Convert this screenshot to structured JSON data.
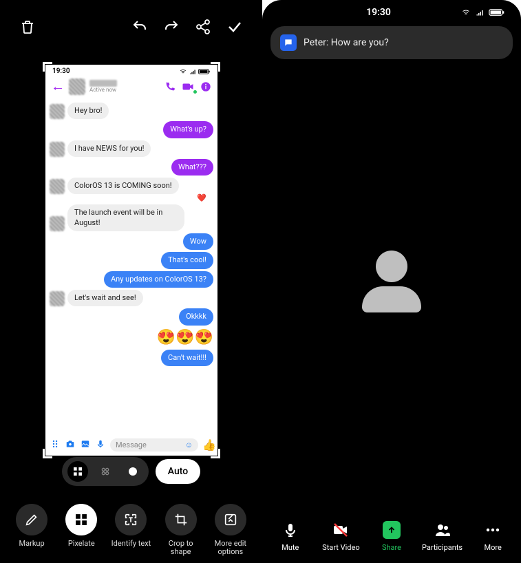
{
  "left": {
    "toolbar": {
      "auto_label": "Auto"
    },
    "tools": [
      {
        "label": "Markup"
      },
      {
        "label": "Pixelate"
      },
      {
        "label": "Identify text"
      },
      {
        "label": "Crop to shape"
      },
      {
        "label": "More edit options"
      }
    ],
    "shot": {
      "status_time": "19:30",
      "active_text": "Active now",
      "input_placeholder": "Message",
      "messages": [
        {
          "dir": "in",
          "text": "Hey bro!",
          "avatar": true
        },
        {
          "dir": "out",
          "style": "purple",
          "text": "What's up?"
        },
        {
          "dir": "in",
          "text": "I have NEWS for you!",
          "avatar": true
        },
        {
          "dir": "out",
          "style": "purple",
          "text": "What???"
        },
        {
          "dir": "in",
          "text": "ColorOS 13 is COMING soon!",
          "avatar": true,
          "react": "❤️"
        },
        {
          "dir": "in",
          "text": "The launch event will be in August!",
          "avatar": true
        },
        {
          "dir": "out",
          "style": "blue",
          "text": "Wow"
        },
        {
          "dir": "out",
          "style": "blue",
          "text": "That's cool!"
        },
        {
          "dir": "out",
          "style": "blue",
          "text": "Any updates on ColorOS 13?"
        },
        {
          "dir": "in",
          "text": "Let's wait and see!",
          "avatar": true
        },
        {
          "dir": "out",
          "style": "blue",
          "text": "Okkkk"
        },
        {
          "dir": "emoji",
          "text": "😍😍😍"
        },
        {
          "dir": "out",
          "style": "blue",
          "text": "Can't wait!!!"
        }
      ]
    }
  },
  "right": {
    "status_time": "19:30",
    "notification": "Peter: How are you?",
    "buttons": [
      {
        "label": "Mute"
      },
      {
        "label": "Start Video"
      },
      {
        "label": "Share"
      },
      {
        "label": "Participants"
      },
      {
        "label": "More"
      }
    ]
  }
}
